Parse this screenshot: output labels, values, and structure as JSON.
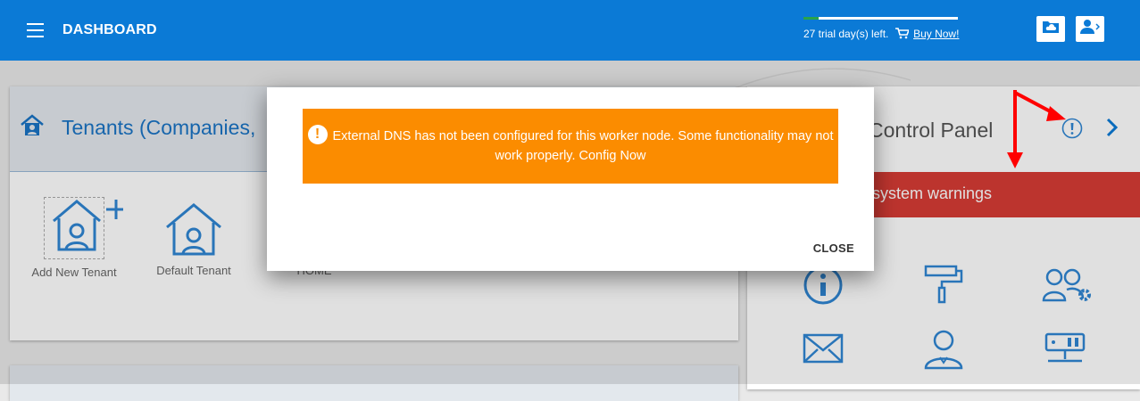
{
  "topbar": {
    "title": "DASHBOARD",
    "trial_progress": 0.1,
    "trial_text": "27 trial day(s) left.",
    "buy_label": "Buy Now!",
    "icons": [
      "menu-icon",
      "cloud-folder-icon",
      "user-switch-icon"
    ]
  },
  "tenants": {
    "title": "Tenants (Companies, ",
    "tiles": [
      {
        "label": "Add New Tenant",
        "icon": "add-house-icon"
      },
      {
        "label": "Default Tenant",
        "icon": "house-user-icon"
      },
      {
        "label": "HOME",
        "icon": "house-icon"
      }
    ]
  },
  "control_panel": {
    "title": "Control Panel",
    "warning": "system warnings",
    "icons": [
      "info-icon",
      "paint-roller-icon",
      "users-settings-icon",
      "mail-icon",
      "user-icon",
      "server-icon"
    ]
  },
  "modal": {
    "message": "External DNS has not been configured for this worker node. Some functionality may not work properly. Config Now",
    "close_label": "CLOSE"
  },
  "colors": {
    "primary": "#0b7ad6",
    "alert": "#fb8c00",
    "danger": "#d63c35",
    "annotation": "#ff0000"
  }
}
